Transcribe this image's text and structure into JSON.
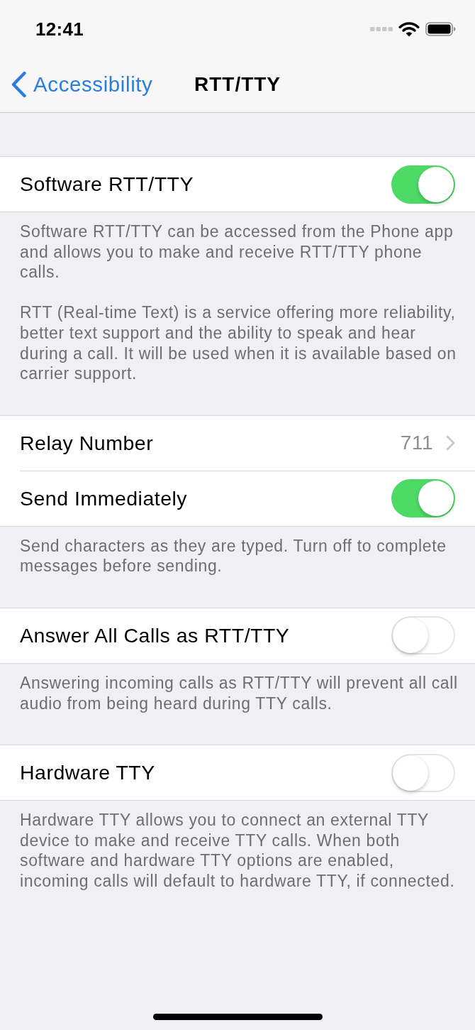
{
  "status_bar": {
    "time": "12:41"
  },
  "nav_bar": {
    "back_label": "Accessibility",
    "title": "RTT/TTY"
  },
  "sections": [
    {
      "rows": [
        {
          "kind": "toggle",
          "label": "Software RTT/TTY",
          "on": true
        }
      ],
      "footer": [
        "Software RTT/TTY can be accessed from the Phone app and allows you to make and receive RTT/TTY phone calls.",
        "RTT (Real-time Text) is a service offering more reliability, better text support and the ability to speak and hear during a call. It will be used when it is available based on carrier support."
      ]
    },
    {
      "rows": [
        {
          "kind": "link",
          "label": "Relay Number",
          "value": "711"
        },
        {
          "kind": "toggle",
          "label": "Send Immediately",
          "on": true
        }
      ],
      "footer": [
        "Send characters as they are typed. Turn off to complete messages before sending."
      ]
    },
    {
      "rows": [
        {
          "kind": "toggle",
          "label": "Answer All Calls as RTT/TTY",
          "on": false
        }
      ],
      "footer": [
        "Answering incoming calls as RTT/TTY will prevent all call audio from being heard during TTY calls."
      ]
    },
    {
      "rows": [
        {
          "kind": "toggle",
          "label": "Hardware TTY",
          "on": false
        }
      ],
      "footer": [
        "Hardware TTY allows you to connect an external TTY device to make and receive TTY calls. When both software and hardware TTY options are enabled, incoming calls will default to hardware TTY, if connected."
      ]
    }
  ]
}
